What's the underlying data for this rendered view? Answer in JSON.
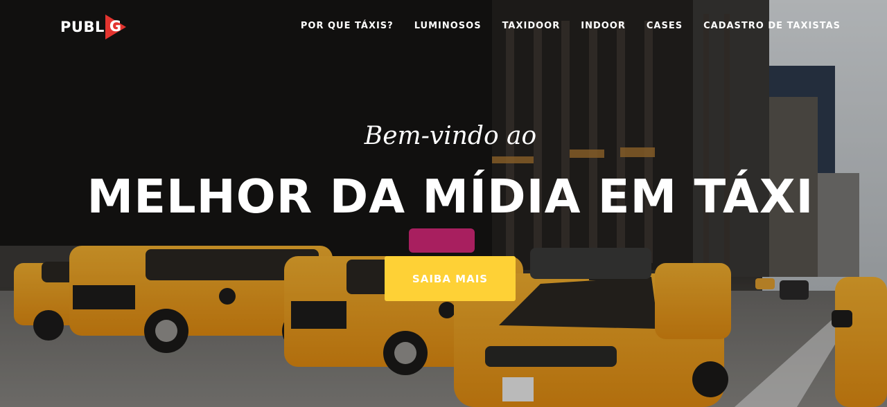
{
  "brand": {
    "logo_text": "PUBL",
    "logo_letter": "G",
    "accent_color": "#e3342f"
  },
  "nav": {
    "items": [
      {
        "label": "POR QUE TÁXIS?"
      },
      {
        "label": "LUMINOSOS"
      },
      {
        "label": "TAXIDOOR"
      },
      {
        "label": "INDOOR"
      },
      {
        "label": "CASES"
      },
      {
        "label": "CADASTRO DE TAXISTAS"
      }
    ]
  },
  "hero": {
    "subheading": "Bem-vindo ao",
    "heading": "MELHOR DA MÍDIA EM TÁXI",
    "cta_label": "SAIBA MAIS",
    "cta_color": "#fed136",
    "background": "city-street-taxis-photo"
  }
}
